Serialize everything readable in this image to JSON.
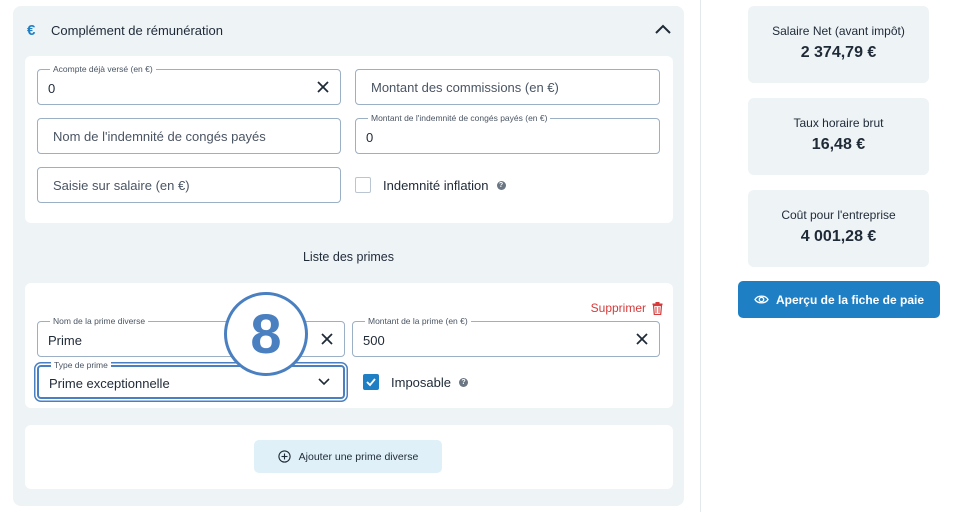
{
  "section": {
    "icon": "euro-icon",
    "icon_glyph": "€",
    "title": "Complément de rémunération"
  },
  "fields": {
    "acompte": {
      "label": "Acompte déjà versé (en €)",
      "value": "0"
    },
    "commissions": {
      "placeholder": "Montant des commissions (en €)"
    },
    "conges_nom": {
      "placeholder": "Nom de l'indemnité de congés payés"
    },
    "conges_montant": {
      "label": "Montant de l'indemnité de congés payés (en €)",
      "value": "0"
    },
    "saisie": {
      "placeholder": "Saisie sur salaire (en €)"
    },
    "inflation": {
      "label": "Indemnité inflation",
      "checked": false
    }
  },
  "primes": {
    "title": "Liste des primes",
    "delete_label": "Supprimer",
    "items": [
      {
        "name_label": "Nom de la prime diverse",
        "name_value": "Prime",
        "amount_label": "Montant de la prime (en €)",
        "amount_value": "500",
        "type_label": "Type de prime",
        "type_value": "Prime exceptionnelle",
        "imposable_label": "Imposable",
        "imposable_checked": true
      }
    ],
    "add_label": "Ajouter une prime diverse"
  },
  "summary": {
    "net": {
      "label": "Salaire Net (avant impôt)",
      "value": "2 374,79 €"
    },
    "taux": {
      "label": "Taux horaire brut",
      "value": "16,48 €"
    },
    "cout": {
      "label": "Coût pour l'entreprise",
      "value": "4 001,28 €"
    }
  },
  "preview_button": "Aperçu de la fiche de paie",
  "step_badge": "8",
  "colors": {
    "accent": "#1e7fc4",
    "danger": "#d63a3a",
    "panel": "#eef3f6",
    "badge": "#4a7fc0"
  }
}
